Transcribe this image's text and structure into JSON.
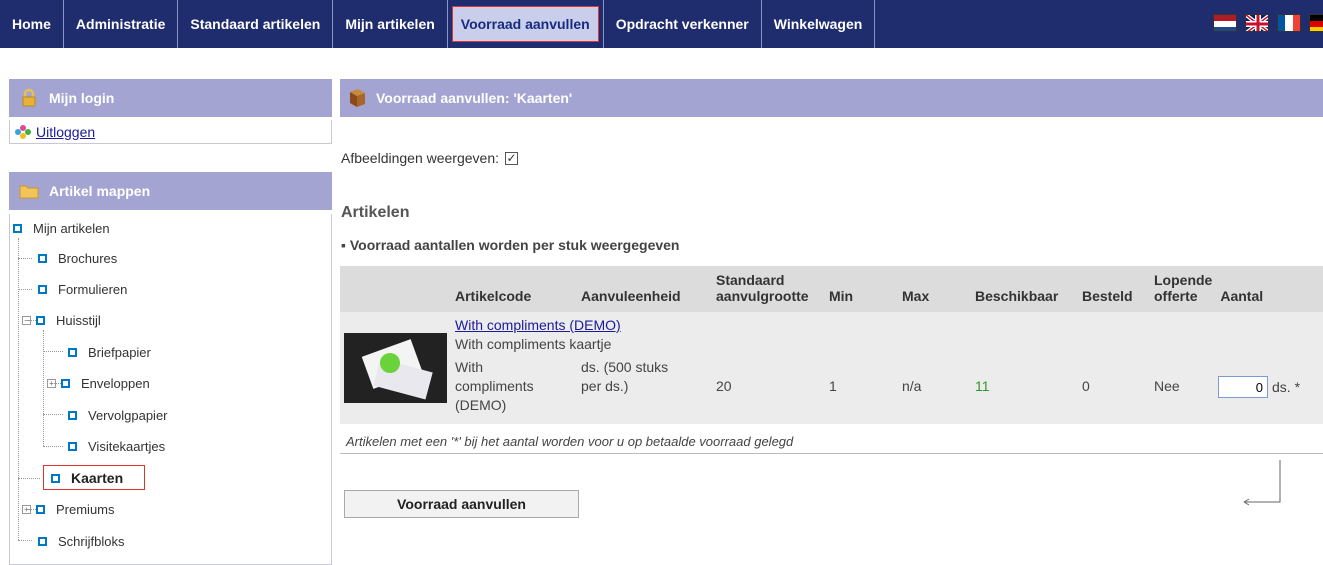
{
  "nav": {
    "items": [
      "Home",
      "Administratie",
      "Standaard artikelen",
      "Mijn artikelen",
      "Voorraad aanvullen",
      "Opdracht verkenner",
      "Winkelwagen"
    ],
    "active_index": 4
  },
  "sidebar": {
    "login_title": "Mijn login",
    "logout_label": "Uitloggen",
    "folders_title": "Artikel mappen",
    "tree": [
      "Mijn artikelen",
      "Brochures",
      "Formulieren",
      "Huisstijl",
      "Briefpapier",
      "Enveloppen",
      "Vervolgpapier",
      "Visitekaartjes",
      "Kaarten",
      "Premiums",
      "Schrijfbloks"
    ]
  },
  "main": {
    "title": "Voorraad aanvullen: 'Kaarten'",
    "show_images_label": "Afbeeldingen weergeven:",
    "show_images_checked": true,
    "section_title": "Artikelen",
    "note": "▪ Voorraad aantallen worden per stuk weergegeven",
    "columns": {
      "code": "Artikelcode",
      "unit": "Aanvuleenheid",
      "std1": "Standaard",
      "std2": "aanvulgrootte",
      "min": "Min",
      "max": "Max",
      "avail": "Beschikbaar",
      "ordered": "Besteld",
      "quote1": "Lopende",
      "quote2": "offerte",
      "qty": "Aantal"
    },
    "row": {
      "name": "With compliments (DEMO)",
      "description": "With compliments kaartje",
      "code1": "With",
      "code2": "compliments",
      "code3": "(DEMO)",
      "unit1": "ds. (500 stuks",
      "unit2": "per ds.)",
      "std": "20",
      "min": "1",
      "max": "n/a",
      "avail": "11",
      "ordered": "0",
      "quote": "Nee",
      "qty": "0",
      "qty_unit": "ds. *"
    },
    "footnote": "Artikelen met een '*' bij het aantal worden voor u op betaalde voorraad gelegd",
    "submit_label": "Voorraad aanvullen"
  },
  "colors": {
    "nav_bg": "#1f2c6e",
    "panel_head": "#a3a4d1",
    "highlight_border": "#dd3333"
  }
}
